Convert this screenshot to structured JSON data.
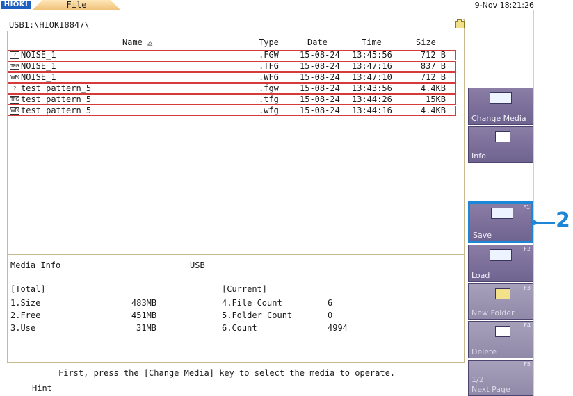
{
  "app": {
    "logo": "HIOKI",
    "tab_label": "File",
    "clock": "9-Nov 18:21:26"
  },
  "path": "USB1:\\HIOKI8847\\",
  "columns": {
    "name": "Name △",
    "type": "Type",
    "date": "Date",
    "time": "Time",
    "size": "Size"
  },
  "files": [
    {
      "icon": "?",
      "name": "NOISE_1",
      "type": ".FGW",
      "date": "15-08-24",
      "time": "13:45:56",
      "size": "712 B"
    },
    {
      "icon": "TFG",
      "name": "NOISE_1",
      "type": ".TFG",
      "date": "15-08-24",
      "time": "13:47:16",
      "size": "837 B"
    },
    {
      "icon": "WFG",
      "name": "NOISE_1",
      "type": ".WFG",
      "date": "15-08-24",
      "time": "13:47:10",
      "size": "712 B"
    },
    {
      "icon": "?",
      "name": "test pattern_5",
      "type": ".fgw",
      "date": "15-08-24",
      "time": "13:43:56",
      "size": "4.4KB"
    },
    {
      "icon": "TFG",
      "name": "test pattern_5",
      "type": ".tfg",
      "date": "15-08-24",
      "time": "13:44:26",
      "size": "15KB"
    },
    {
      "icon": "WFG",
      "name": "test pattern_5",
      "type": ".wfg",
      "date": "15-08-24",
      "time": "13:44:16",
      "size": "4.4KB"
    }
  ],
  "media_info": {
    "title": "Media Info",
    "media": "USB",
    "total_label": "[Total]",
    "current_label": "[Current]",
    "size_label": "1.Size",
    "size_value": "483MB",
    "free_label": "2.Free",
    "free_value": "451MB",
    "use_label": "3.Use",
    "use_value": "31MB",
    "file_count_label": "4.File Count",
    "file_count_value": "6",
    "folder_count_label": "5.Folder Count",
    "folder_count_value": "0",
    "count_label": "6.Count",
    "count_value": "4994"
  },
  "hint": {
    "message": "First, press the [Change Media] key to select the media to operate.",
    "label": "Hint"
  },
  "function_keys": {
    "change_media": "Change Media",
    "info": "Info",
    "save": "Save",
    "save_fn": "F1",
    "load": "Load",
    "load_fn": "F2",
    "new_folder": "New Folder",
    "new_folder_fn": "F3",
    "delete": "Delete",
    "delete_fn": "F4",
    "next_page": "Next Page",
    "next_page_sub": "1/2",
    "next_page_fn": "F5"
  },
  "callout": "2"
}
